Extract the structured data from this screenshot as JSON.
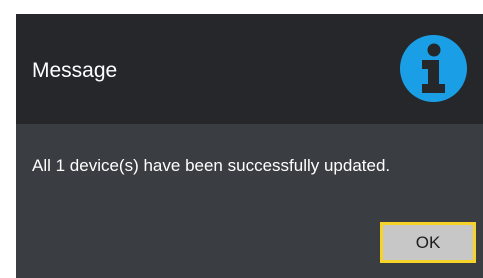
{
  "dialog": {
    "title": "Message",
    "icon": "info-icon",
    "message": "All 1 device(s) have been successfully updated.",
    "ok_label": "OK"
  },
  "colors": {
    "header_background": "#25272b",
    "body_background": "#3a3d42",
    "icon_accent": "#1a9fe6",
    "button_background": "#c7c7c7",
    "button_focus_border": "#f5d328"
  }
}
